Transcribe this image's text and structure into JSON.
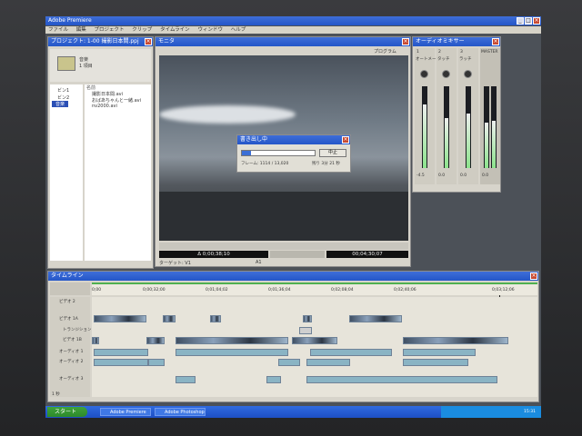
{
  "app": {
    "title": "Adobe Premiere"
  },
  "menu": {
    "items": [
      "ファイル",
      "編集",
      "プロジェクト",
      "クリップ",
      "タイムライン",
      "ウィンドウ",
      "ヘルプ"
    ]
  },
  "project": {
    "title": "プロジェクト: 1-00 撮影日本間.ppj",
    "bin_name": "音楽",
    "bin_count": "1 項目",
    "col_name": "名前",
    "bins": [
      "ビン1",
      "ビン2",
      "音楽"
    ],
    "files": [
      "撮影日本間.avi",
      "おばあちゃんと一緒.avi",
      "nv2000.avi"
    ]
  },
  "monitor": {
    "title": "モニタ",
    "tab": "プログラム",
    "timecode_left": "Δ 0;00;38;10",
    "timecode_right": "00;04;30;07",
    "target_label": "ターゲット: V1",
    "audio_label": "A1"
  },
  "export_dialog": {
    "title": "書き出し中",
    "stop_label": "中止",
    "progress": 0.12,
    "status": "フレーム: 1114 / 13,020",
    "remaining": "残り 3分 21 秒"
  },
  "mixer": {
    "title": "オーディオミキサー",
    "channels": [
      {
        "name": "1",
        "db": "-4.5"
      },
      {
        "name": "2",
        "db": "0.0"
      },
      {
        "name": "3",
        "db": "0.0"
      }
    ],
    "master": "MASTER",
    "master_db": "0.0",
    "mode_labels": [
      "オートメーション",
      "タッチ",
      "ラッチ"
    ]
  },
  "timeline": {
    "title": "タイムライン",
    "ruler": [
      "0;00",
      "0;00;32;00",
      "0;01;04;02",
      "0;01;36;04",
      "0;02;08;04",
      "0;02;40;06",
      "0;03;12;06"
    ],
    "tracks": [
      "ビデオ 2",
      "ビデオ 1A",
      "トランジション",
      "ビデオ 1B",
      "オーディオ 1",
      "オーディオ 2",
      "オーディオ 3"
    ],
    "zoom": "1 秒"
  },
  "taskbar": {
    "start": "スタート",
    "tasks": [
      "Adobe Premiere",
      "Adobe Photoshop"
    ],
    "clock": "15:31"
  },
  "colors": {
    "titlebar": "#2456c8",
    "panel": "#d7d4cb",
    "sky": "#6f7a85",
    "taskbar": "#1d4fc4"
  }
}
